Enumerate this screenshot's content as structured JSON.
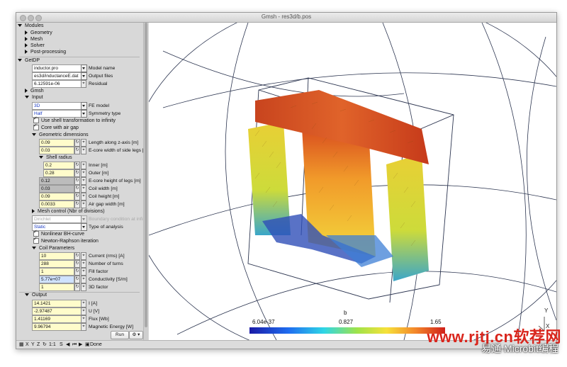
{
  "window": {
    "title": "Gmsh - res3d/b.pos"
  },
  "tree": {
    "modules": "Modules",
    "geometry": "Geometry",
    "mesh": "Mesh",
    "solver": "Solver",
    "postprocessing": "Post-processing",
    "getdp": "GetDP",
    "gmsh": "Gmsh",
    "input": "Input",
    "output": "Output"
  },
  "getdp": {
    "model_value": "inductor.pro",
    "model_label": "Model name",
    "output_value": "es3d/inductanceE.dat",
    "output_label": "Output files",
    "residual_value": "6.12591e-06",
    "residual_label": "Residual"
  },
  "input": {
    "fe_model_value": "3D",
    "fe_model_label": "FE model",
    "symmetry_value": "Half",
    "symmetry_label": "Symmetry type",
    "shell_transform": "Use shell transformation to infinity",
    "core_air_gap": "Core with air gap",
    "geom_dims": "Geometric dimensions",
    "length_z_value": "0.09",
    "length_z_label": "Length along z-axis [m]",
    "ecore_width_value": "0.03",
    "ecore_width_label": "E-core width of side legs [m",
    "shell_radius": "Shell radius",
    "inner_value": "0.2",
    "inner_label": "Inner [m]",
    "outer_value": "0.28",
    "outer_label": "Outer [m]",
    "ecore_height_value": "0.12",
    "ecore_height_label": "E-core height of legs [m]",
    "coil_width_value": "0.03",
    "coil_width_label": "Coil width [m]",
    "coil_height_value": "0.09",
    "coil_height_label": "Coil height [m]",
    "air_gap_value": "0.0033",
    "air_gap_label": "Air gap width [m]",
    "mesh_control": "Mesh control (Nbr of divisions)",
    "boundary_value": "Dirichlet",
    "boundary_label": "Boundary condition at infini",
    "analysis_value": "Static",
    "analysis_label": "Type of analysis",
    "nonlinear": "Nonlinear BH-curve",
    "newton": "Newton-Raphson iteration",
    "coil_params": "Coil Parameters",
    "current_value": "10",
    "current_label": "Current (rms) [A]",
    "turns_value": "288",
    "turns_label": "Number of turns",
    "fill_value": "1",
    "fill_label": "Fill factor",
    "conductivity_value": "5.77e+07",
    "conductivity_label": "Conductivity [S/m]",
    "factor3d_value": "1",
    "factor3d_label": "3D factor"
  },
  "output": {
    "i_value": "14.1421",
    "i_label": "I [A]",
    "u_value": "-2.97487",
    "u_label": "U [V]",
    "flux_value": "1.41169",
    "flux_label": "Flux [Wb]",
    "energy_value": "9.96794",
    "energy_label": "Magnetic Energy [W]"
  },
  "buttons": {
    "run": "Run",
    "gear": "⚙ ▾"
  },
  "status": {
    "x": "X",
    "y": "Y",
    "z": "Z",
    "rot": "↻",
    "scale": "1:1",
    "s": "S",
    "done": "Done"
  },
  "colorbar": {
    "title": "b",
    "min": "6.04e-37",
    "mid": "0.827",
    "max": "1.65"
  },
  "axes": {
    "y": "Y",
    "x": "X"
  },
  "watermark": {
    "line1": "www.rjtj.cn软荐网",
    "line2": "易通 Microbit编程"
  },
  "colors": {
    "accent_blue": "#1b3cc4",
    "field_yellow": "#fffccb"
  }
}
